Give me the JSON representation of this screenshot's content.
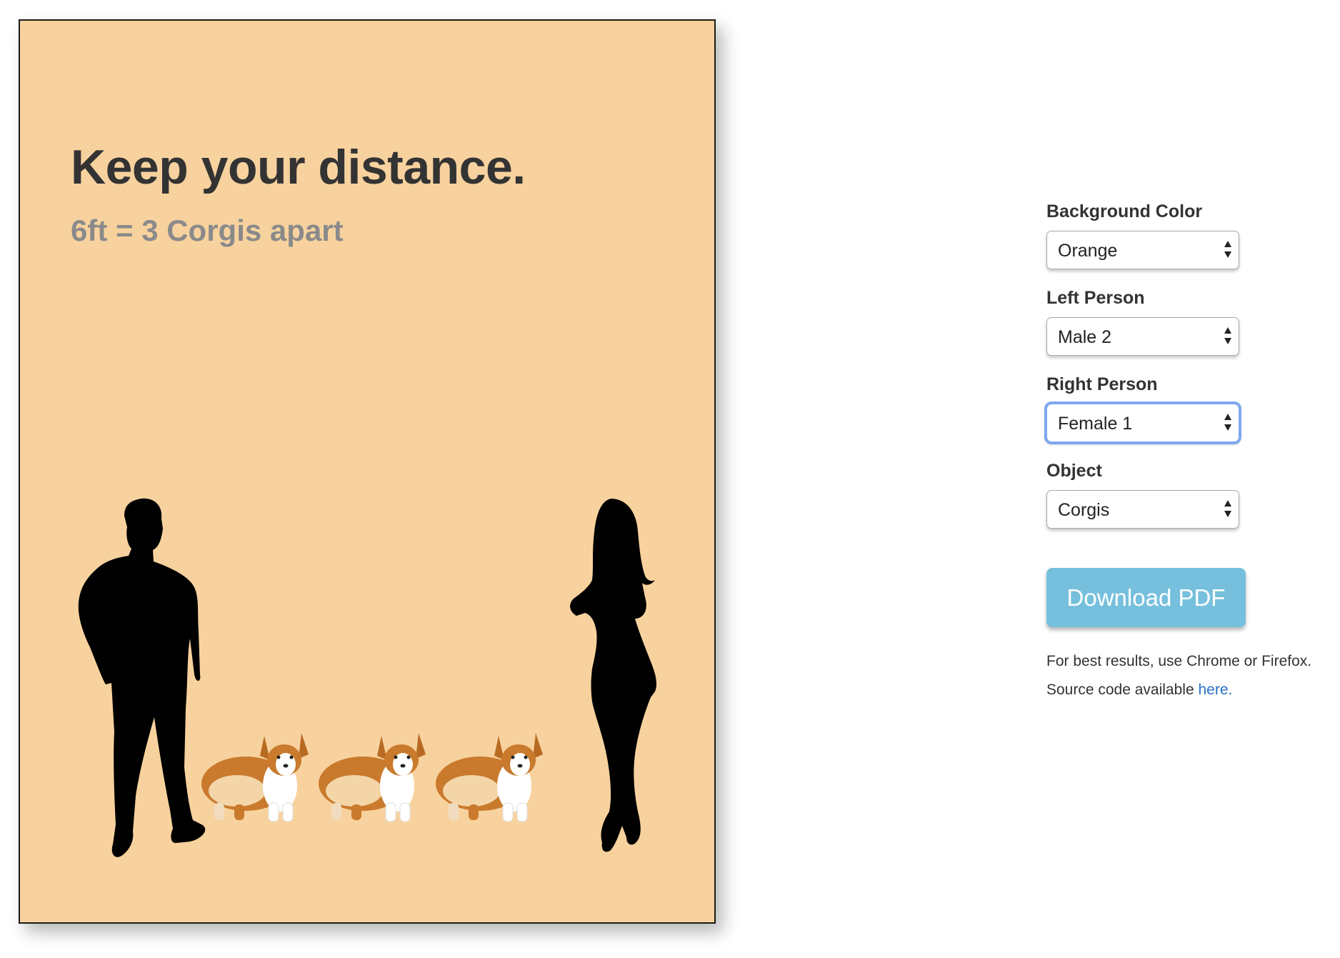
{
  "poster": {
    "title": "Keep your distance.",
    "subtitle": "6ft = 3 Corgis apart",
    "background_color": "#f8d29e",
    "left_figure": "male-silhouette",
    "right_figure": "female-silhouette",
    "objects": [
      "corgi",
      "corgi",
      "corgi"
    ]
  },
  "controls": {
    "background": {
      "label": "Background Color",
      "value": "Orange"
    },
    "left_person": {
      "label": "Left Person",
      "value": "Male 2"
    },
    "right_person": {
      "label": "Right Person",
      "value": "Female 1"
    },
    "object": {
      "label": "Object",
      "value": "Corgis"
    },
    "download_label": "Download PDF",
    "note_browser": "For best results, use Chrome or Firefox.",
    "note_source_prefix": "Source code available ",
    "note_source_link": "here."
  },
  "colors": {
    "button": "#76c0dd",
    "link": "#2a71c5",
    "focus": "#7fa7ee"
  }
}
